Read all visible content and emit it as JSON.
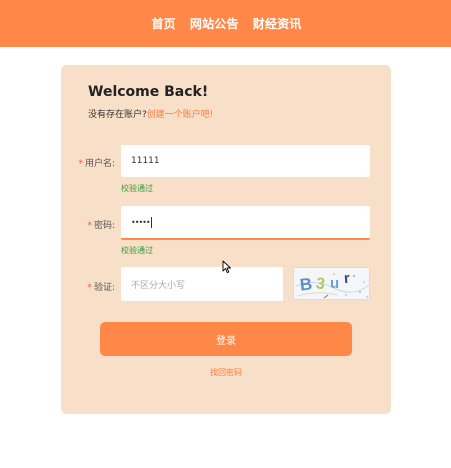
{
  "nav": {
    "items": [
      {
        "label": "首页"
      },
      {
        "label": "网站公告"
      },
      {
        "label": "财经资讯"
      }
    ]
  },
  "form": {
    "title": "Welcome Back!",
    "subtitle_prefix": "没有存在账户?",
    "subtitle_link": "创建一个账户吧!",
    "username": {
      "label": "用户名:",
      "value": "11111",
      "status": "校验通过"
    },
    "password": {
      "label": "密码:",
      "value": "•••••",
      "status": "校验通过"
    },
    "captcha": {
      "label": "验证:",
      "placeholder": "不区分大小写",
      "image_text": "B3ur"
    },
    "submit_label": "登录",
    "forgot_label": "找回密码"
  },
  "colors": {
    "accent": "#ff8849",
    "card_bg": "#f8dfc7",
    "success": "#2e9e3a",
    "required": "#ff4d4f"
  }
}
